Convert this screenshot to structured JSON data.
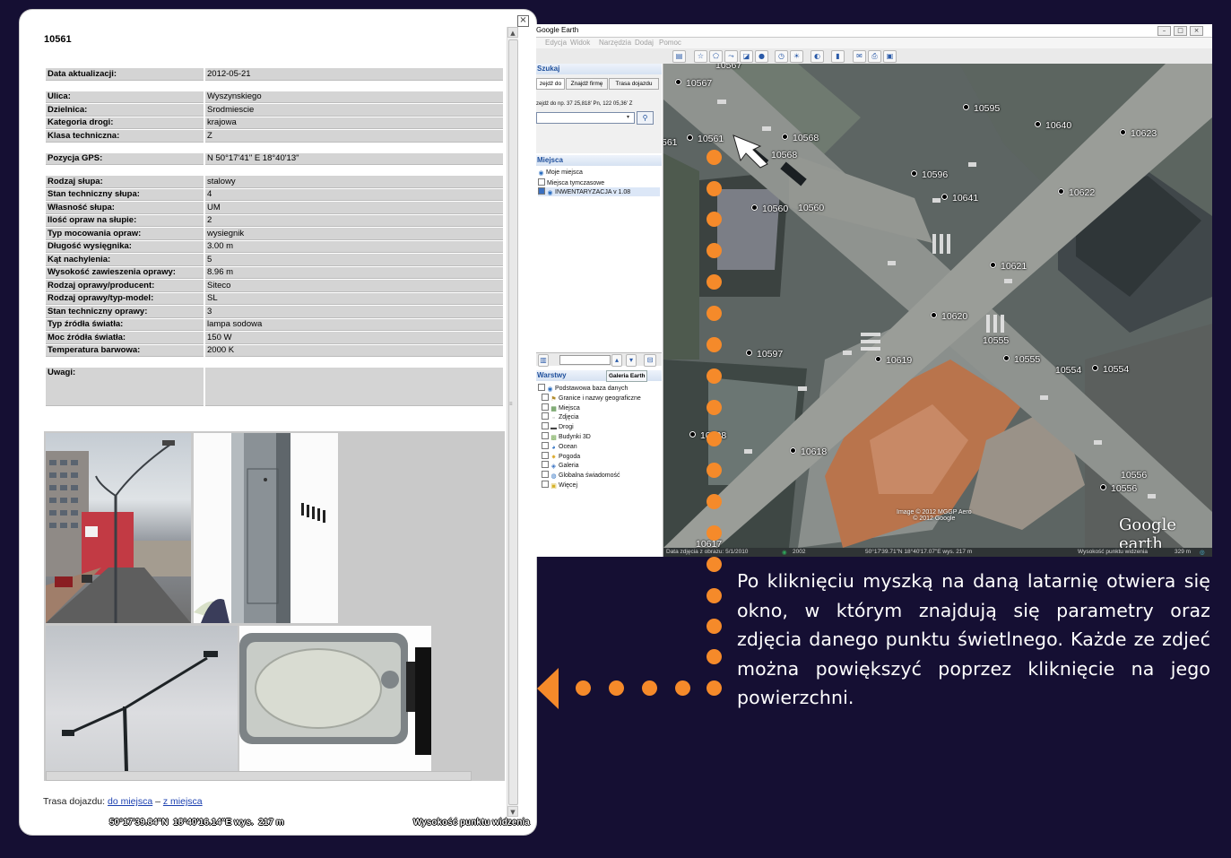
{
  "popup": {
    "close_glyph": "×",
    "lamp_id": "10561",
    "rows": [
      {
        "group": 1,
        "key": "Data aktualizacji:",
        "value": "2012-05-21"
      },
      {
        "group": 2,
        "key": "Ulica:",
        "value": "Wyszynskiego"
      },
      {
        "group": 2,
        "key": "Dzielnica:",
        "value": "Srodmiescie"
      },
      {
        "group": 2,
        "key": "Kategoria drogi:",
        "value": "krajowa"
      },
      {
        "group": 2,
        "key": "Klasa techniczna:",
        "value": "Z"
      },
      {
        "group": 3,
        "key": "Pozycja GPS:",
        "value": "N 50°17'41\"   E 18°40'13\""
      },
      {
        "group": 4,
        "key": "Rodzaj słupa:",
        "value": "stalowy"
      },
      {
        "group": 4,
        "key": "Stan techniczny słupa:",
        "value": "4"
      },
      {
        "group": 4,
        "key": "Własność słupa:",
        "value": "UM"
      },
      {
        "group": 4,
        "key": "Ilość opraw na słupie:",
        "value": "2"
      },
      {
        "group": 4,
        "key": "Typ mocowania opraw:",
        "value": "wysiegnik"
      },
      {
        "group": 4,
        "key": "Długość wysięgnika:",
        "value": "3.00 m"
      },
      {
        "group": 4,
        "key": "Kąt nachylenia:",
        "value": "5"
      },
      {
        "group": 4,
        "key": "Wysokość zawieszenia oprawy:",
        "value": "8.96 m"
      },
      {
        "group": 4,
        "key": "Rodzaj oprawy/producent:",
        "value": "Siteco"
      },
      {
        "group": 4,
        "key": "Rodzaj oprawy/typ-model:",
        "value": "SL"
      },
      {
        "group": 4,
        "key": "Stan techniczny oprawy:",
        "value": "3"
      },
      {
        "group": 4,
        "key": "Typ źródła światła:",
        "value": "lampa sodowa"
      },
      {
        "group": 4,
        "key": "Moc źródła światła:",
        "value": "150 W"
      },
      {
        "group": 4,
        "key": "Temperatura barwowa:",
        "value": "2000 K"
      }
    ],
    "notes_label": "Uwagi:",
    "notes_value": "",
    "trasa_label": "Trasa dojazdu:",
    "trasa_to": "do miejsca",
    "trasa_sep": "–",
    "trasa_from": "z miejsca",
    "coords": "50°17'39.84\"N  18°40'16.14\"E wys.  217 m",
    "elevation_label": "Wysokość punktu widzenia"
  },
  "ge": {
    "title": "Google Earth",
    "menu": [
      "Edycja",
      "Widok",
      "Narzędzia",
      "Dodaj",
      "Pomoc"
    ],
    "search": {
      "header": "Szukaj",
      "tabs": [
        "zejdź do",
        "Znajdź firmę",
        "Trasa dojazdu"
      ],
      "hint": "zejdź do np. 37 25,818' Pn, 122 05,36' Z"
    },
    "places": {
      "header": "Miejsca",
      "items": [
        "Moje miejsca",
        "Miejsca tymczasowe",
        "INWENTARYZACJA v 1.08"
      ]
    },
    "layers": {
      "header": "Warstwy",
      "gallery_button": "Galeria Earth",
      "items": [
        "Podstawowa baza danych",
        "Granice i nazwy geograficzne",
        "Miejsca",
        "Zdjęcia",
        "Drogi",
        "Budynki 3D",
        "Ocean",
        "Pogoda",
        "Galeria",
        "Globalna świadomość",
        "Więcej"
      ]
    },
    "map": {
      "pins": [
        {
          "label": "10567",
          "pos": "a"
        },
        {
          "label": "10567",
          "pos": "b"
        },
        {
          "label": "561",
          "pos": "c"
        },
        {
          "label": "10561",
          "pos": "d"
        },
        {
          "label": "10568",
          "pos": "e"
        },
        {
          "label": "10568",
          "pos": "f"
        },
        {
          "label": "10595",
          "pos": "g"
        },
        {
          "label": "10640",
          "pos": "h"
        },
        {
          "label": "10623",
          "pos": "i"
        },
        {
          "label": "10596",
          "pos": "j"
        },
        {
          "label": "10641",
          "pos": "k"
        },
        {
          "label": "10622",
          "pos": "l"
        },
        {
          "label": "10560",
          "pos": "m"
        },
        {
          "label": "10560",
          "pos": "n"
        },
        {
          "label": "10621",
          "pos": "o"
        },
        {
          "label": "10620",
          "pos": "p"
        },
        {
          "label": "10555",
          "pos": "q"
        },
        {
          "label": "10555",
          "pos": "r"
        },
        {
          "label": "10597",
          "pos": "s"
        },
        {
          "label": "10619",
          "pos": "t"
        },
        {
          "label": "10554",
          "pos": "u"
        },
        {
          "label": "10554",
          "pos": "v"
        },
        {
          "label": "10598",
          "pos": "w"
        },
        {
          "label": "10618",
          "pos": "x"
        },
        {
          "label": "10556",
          "pos": "y"
        },
        {
          "label": "10556",
          "pos": "z"
        },
        {
          "label": "10617",
          "pos": "aa"
        }
      ],
      "attribution_1": "Image © 2012 MGGP Aero",
      "attribution_2": "© 2012 Google",
      "logo": "Google earth",
      "status_date": "Data zdjęcia z obrazu: 5/1/2010",
      "status_year": "2002",
      "status_coords": "50°17'39.71\"N  18°40'17.07\"E  wys.  217 m",
      "status_elev": "Wysokość punktu widzenia",
      "status_alt": "329 m"
    }
  },
  "description": "Po kliknięciu myszką na daną latarnię otwiera się okno, w którym znajdują się parametry oraz zdjęcia danego punktu świetlnego. Każde ze zdjeć można powiększyć poprzez kliknięcie na jego powierzchni.",
  "colors": {
    "accent": "#f58a2a",
    "background": "#150f33"
  }
}
